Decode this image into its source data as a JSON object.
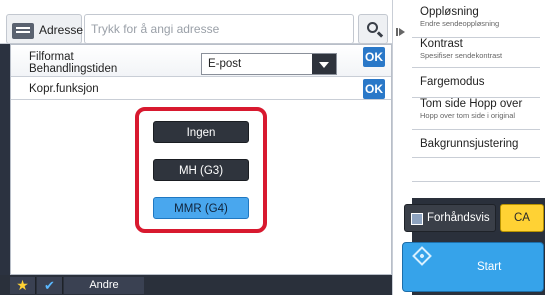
{
  "header": {
    "address_label": "Adresse",
    "address_placeholder": "Trykk for å angi adresse"
  },
  "panel": {
    "file_format": {
      "label_line1": "Filformat",
      "label_line2": "Behandlingstiden",
      "selected_value": "E-post",
      "ok_label": "OK"
    },
    "compression": {
      "label": "Kopr.funksjon",
      "ok_label": "OK",
      "options": [
        {
          "label": "Ingen",
          "selected": false
        },
        {
          "label": "MH (G3)",
          "selected": false
        },
        {
          "label": "MMR (G4)",
          "selected": true
        }
      ]
    }
  },
  "right_menu": {
    "items": [
      {
        "label": "Oppløsning",
        "sub": "Endre sendeoppløsning"
      },
      {
        "label": "Kontrast",
        "sub": "Spesifiser sendekontrast"
      },
      {
        "label": "Fargemodus",
        "sub": ""
      },
      {
        "label": "Tom side Hopp over",
        "sub": "Hopp over tom side i original"
      },
      {
        "label": "Bakgrunnsjustering",
        "sub": ""
      }
    ],
    "preview_label": "Forhåndsvis",
    "ca_label": "CA",
    "start_label": "Start"
  },
  "bottom_bar": {
    "other_label": "Andre"
  },
  "colors": {
    "accent_blue": "#2a78c8",
    "selected_option": "#49a7ee",
    "focus_frame_red": "#d8192f",
    "ca_yellow": "#ffd234",
    "start_blue": "#36a3ea"
  }
}
